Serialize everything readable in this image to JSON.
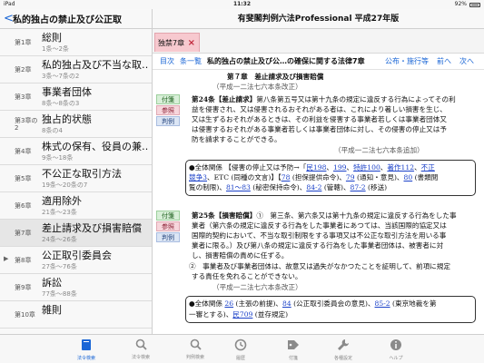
{
  "status": {
    "carrier": "iPad",
    "time": "11:32",
    "battery": "92%"
  },
  "sidebar": {
    "back": "<",
    "title": "私的独占の禁止及び公正取",
    "items": [
      {
        "chapter": "第1章",
        "name": "総則",
        "range": "1条～2条"
      },
      {
        "chapter": "第2章",
        "name": "私的独占及び不当な取…",
        "range": "3条～7条の2"
      },
      {
        "chapter": "第3章",
        "name": "事業者団体",
        "range": "8条～8条の3"
      },
      {
        "chapter": "第3章の2",
        "name": "独占的状態",
        "range": "8条の4"
      },
      {
        "chapter": "第4章",
        "name": "株式の保有、役員の兼…",
        "range": "9条～18条"
      },
      {
        "chapter": "第5章",
        "name": "不公正な取引方法",
        "range": "19条～20条の7"
      },
      {
        "chapter": "第6章",
        "name": "適用除外",
        "range": "21条～23条"
      },
      {
        "chapter": "第7章",
        "name": "差止請求及び損害賠償",
        "range": "24条～26条"
      },
      {
        "chapter": "第8章",
        "name": "公正取引委員会",
        "range": "27条～76条",
        "arrow": "▶"
      },
      {
        "chapter": "第9章",
        "name": "訴訟",
        "range": "77条～88条"
      },
      {
        "chapter": "第10章",
        "name": "雑則",
        "range": ""
      }
    ]
  },
  "header": {
    "title": "有斐閣判例六法Professional 平成27年版"
  },
  "tab": {
    "label": "独禁7章",
    "close": "×"
  },
  "nav": {
    "contents": "目次",
    "article_list": "条一覧",
    "title": "私的独占の禁止及び公…の確保に関する法律7章",
    "promulgation": "公布・施行等",
    "prev": "前へ",
    "next": "次へ"
  },
  "content": {
    "chapter_heading": "第７章　差止請求及び損害賠償",
    "a24_amend": "（平成一二法七六本条改正）",
    "tags": {
      "kihen": "付箋",
      "sansho": "参照",
      "hanrei": "判例"
    },
    "a24": {
      "num": "第24条",
      "caption": "【差止請求】",
      "l1": "第八条第五号又は第十九条の規定に違反する行為によってその利",
      "l2": "益を侵害され、又は侵害されるおそれがある者は、これにより著しい損害を生じ、",
      "l3": "又は生ずるおそれがあるときは、その利益を侵害する事業者若しくは事業者団体又",
      "l4": "は侵害するおそれがある事業者若しくは事業者団体に対し、その侵害の停止又は予",
      "l5": "防を請求することができる。",
      "note": "（平成一二法七六本条追加）"
    },
    "ref24": {
      "r1a": "●全体関係 【侵害の停止又は予防→「",
      "r1links": [
        "民198",
        "199",
        "特許100",
        "著作112",
        "不正"
      ],
      "r2a": "競争3",
      "r2b": "、ETC (同種の文言)】",
      "r2links": [
        "78",
        "79",
        "80"
      ],
      "r2c": " (担保提供命令)、",
      "r2d": " (通知・意見)、",
      "r2e": " (書類閲",
      "r3a": "覧の制限)、",
      "r3links": [
        "81～83",
        "84-2",
        "87-2"
      ],
      "r3b": " (秘密保持命令)、",
      "r3c": " (管轄)、",
      "r3d": " (移送)"
    },
    "a25": {
      "num": "第25条",
      "caption": "【損害賠償】",
      "l1": "①　第三条、第六条又は第十九条の規定に違反する行為をした事",
      "l2": "業者（第六条の規定に違反する行為をした事業者にあつては、当該国際的協定又は",
      "l3": "国際的契約において、不当な取引制限をする事項又は不公正な取引方法を用いる事",
      "l4": "業者に限る。）及び第八条の規定に違反する行為をした事業者団体は、被害者に対",
      "l5": "し、損害賠償の責めに任ずる。",
      "l6": "②　事業者及び事業者団体は、故意又は過失がなかつたことを証明して、前項に規定",
      "l7": "する責任を免れることができない。",
      "note": "（平成一二法七六本条改正）"
    },
    "ref25": {
      "r1a": "●全体関係 ",
      "r1links": [
        "26",
        "84",
        "85-2"
      ],
      "r1b": " (主張の前提)、",
      "r1c": " (公正取引委員会の意見)、",
      "r1d": " (東京地裁を第",
      "r2a": "一審とする)、",
      "r2link": "民709",
      "r2b": " (並存規定)"
    }
  },
  "bottom": {
    "tabs": [
      {
        "label": "法令検索",
        "icon": "book-icon"
      },
      {
        "label": "法令検索",
        "icon": "search-icon"
      },
      {
        "label": "判例検索",
        "icon": "search-icon"
      },
      {
        "label": "履歴",
        "icon": "history-icon"
      },
      {
        "label": "付箋",
        "icon": "tag-icon"
      },
      {
        "label": "各種設定",
        "icon": "wrench-icon"
      },
      {
        "label": "ヘルプ",
        "icon": "info-icon"
      }
    ]
  }
}
